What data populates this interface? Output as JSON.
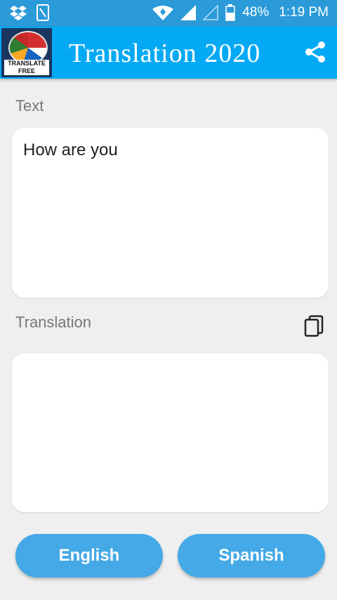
{
  "statusbar": {
    "battery": "48%",
    "time": "1:19 PM"
  },
  "app": {
    "title": "Translation 2020",
    "logo_line1": "TRANSLATE",
    "logo_line2": "FREE"
  },
  "source": {
    "label": "Text",
    "value": "How are you"
  },
  "target": {
    "label": "Translation",
    "value": ""
  },
  "languages": {
    "from": "English",
    "to": "Spanish"
  },
  "colors": {
    "statusbar": "#2b9ad8",
    "appbar": "#03a9f4",
    "button": "#44a9e6",
    "background": "#efefef"
  }
}
